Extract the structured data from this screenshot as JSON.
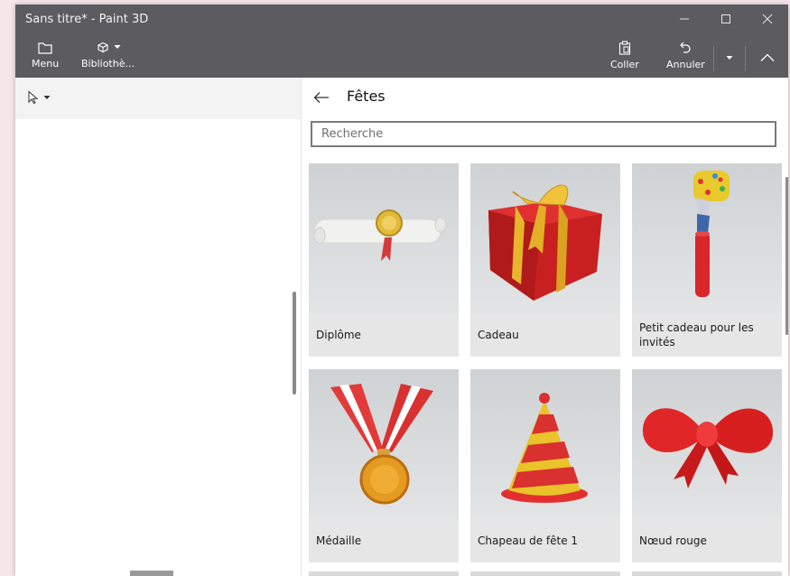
{
  "window": {
    "title": "Sans titre* - Paint 3D"
  },
  "titlebar": {
    "minimize_icon": "minimize-icon",
    "maximize_icon": "maximize-icon",
    "close_icon": "close-icon"
  },
  "commandbar": {
    "menu_label": "Menu",
    "library_label": "Bibliothè...",
    "paste_label": "Coller",
    "undo_label": "Annuler"
  },
  "panel": {
    "title": "Fêtes",
    "search_placeholder": "Recherche",
    "items": [
      {
        "label": "Diplôme"
      },
      {
        "label": "Cadeau"
      },
      {
        "label": "Petit cadeau pour les invités"
      },
      {
        "label": "Médaille"
      },
      {
        "label": "Chapeau de fête 1"
      },
      {
        "label": "Nœud rouge"
      }
    ]
  },
  "colors": {
    "titlebar": "#5b5b60",
    "accent_red": "#d32a2a",
    "gold": "#e3b32a"
  }
}
